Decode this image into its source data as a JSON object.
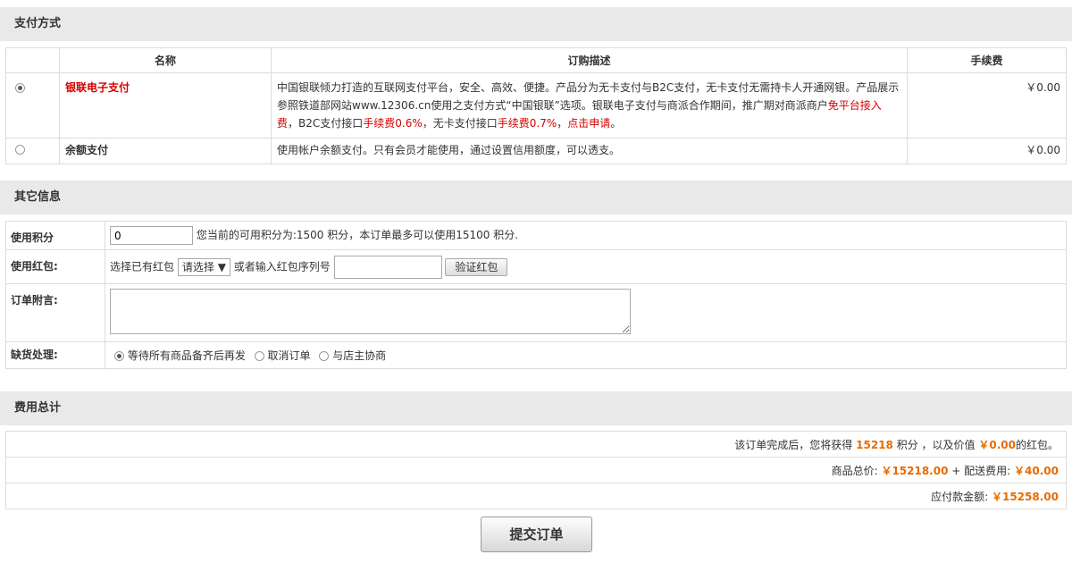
{
  "payment": {
    "section_title": "支付方式",
    "col_name": "名称",
    "col_desc": "订购描述",
    "col_fee": "手续费",
    "options": [
      {
        "name": "银联电子支付",
        "selected": true,
        "desc_part1": "中国银联倾力打造的互联网支付平台，安全、高效、便捷。产品分为无卡支付与B2C支付，无卡支付无需持卡人开通网银。产品展示参照铁道部网站www.12306.cn使用之支付方式“中国银联”选项。银联电子支付与商派合作期间，推广期对商派商户",
        "desc_red1": "免平台接入费",
        "desc_part2": "，B2C支付接口",
        "desc_red2": "手续费0.6%",
        "desc_part3": "，无卡支付接口",
        "desc_red3": "手续费0.7%",
        "desc_part4": "，",
        "desc_red4": "点击申请",
        "desc_part5": "。",
        "fee": "￥0.00"
      },
      {
        "name": "余额支付",
        "selected": false,
        "desc": "使用帐户余额支付。只有会员才能使用，通过设置信用额度，可以透支。",
        "fee": "￥0.00"
      }
    ]
  },
  "other": {
    "section_title": "其它信息",
    "points_label": "使用积分",
    "points_value": "0",
    "points_hint": "您当前的可用积分为:1500 积分，本订单最多可以使用15100 积分.",
    "redpacket_label": "使用红包:",
    "redpacket_choose": "选择已有红包",
    "redpacket_select": "请选择",
    "redpacket_or": "或者输入红包序列号",
    "redpacket_verify": "验证红包",
    "remark_label": "订单附言:",
    "shortage_label": "缺货处理:",
    "shortage_options": [
      "等待所有商品备齐后再发",
      "取消订单",
      "与店主协商"
    ]
  },
  "total": {
    "section_title": "费用总计",
    "row1_a": "该订单完成后，您将获得",
    "row1_points": "15218",
    "row1_b": "积分 ，以及价值",
    "row1_value": "￥0.00",
    "row1_c": "的红包。",
    "row2_a": "商品总价:",
    "row2_goods": "￥15218.00",
    "row2_b": "+ 配送费用:",
    "row2_ship": "￥40.00",
    "row3_a": "应付款金额:",
    "row3_total": "￥15258.00"
  },
  "submit_label": "提交订单"
}
